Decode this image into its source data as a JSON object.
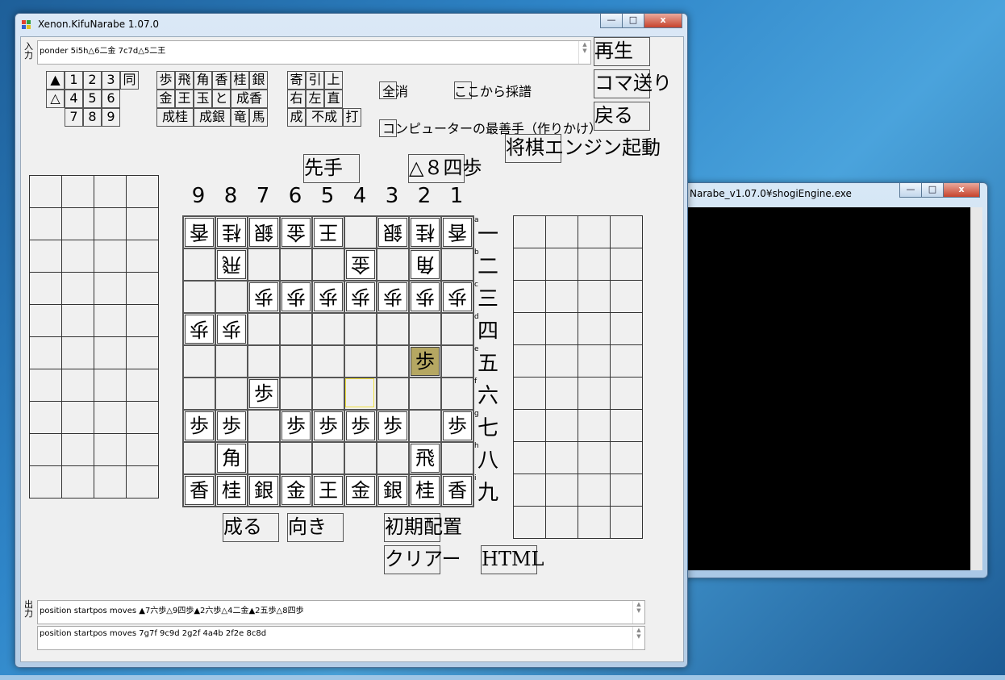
{
  "main_window": {
    "title": "Xenon.KifuNarabe 1.07.0"
  },
  "console_window": {
    "title": "Narabe_v1.07.0¥shogiEngine.exe"
  },
  "window_buttons": {
    "minimize": "—",
    "maximize": "□",
    "close": "x"
  },
  "input": {
    "label": "入力",
    "value": "ponder 5i5h△6二金 7c7d△5二王"
  },
  "output": {
    "label": "出力",
    "line1": "position startpos moves ▲7六歩△9四歩▲2六歩△4二金▲2五歩△8四歩",
    "line2": "position startpos moves 7g7f 9c9d 2g2f 4a4b 2f2e 8c8d"
  },
  "side_buttons": {
    "play": "再生",
    "step": "コマ送り",
    "back": "戻る",
    "engine": "将棋エンジン起動"
  },
  "keypad": {
    "row1": [
      "▲",
      "1",
      "2",
      "3",
      "同"
    ],
    "row2": [
      "△",
      "4",
      "5",
      "6"
    ],
    "row3": [
      "7",
      "8",
      "9"
    ]
  },
  "piece_buttons": {
    "row1": [
      "歩",
      "飛",
      "角",
      "香",
      "桂",
      "銀"
    ],
    "row2": [
      "金",
      "王",
      "玉",
      "と",
      "成香"
    ],
    "row3": [
      "成桂",
      "成銀",
      "竜",
      "馬"
    ]
  },
  "modifier_buttons": {
    "row1": [
      "寄",
      "引",
      "上"
    ],
    "row2": [
      "右",
      "左",
      "直"
    ],
    "row3": [
      "成",
      "不成",
      "打"
    ]
  },
  "options": {
    "clear_all": "全消",
    "record_from_here": "ここから採譜",
    "best_move": "コンピューターの最善手（作りかけ）"
  },
  "turn": {
    "label": "先手"
  },
  "last_move": {
    "label": "△８四歩"
  },
  "files": [
    "9",
    "8",
    "7",
    "6",
    "5",
    "4",
    "3",
    "2",
    "1"
  ],
  "ranks": [
    "一",
    "二",
    "三",
    "四",
    "五",
    "六",
    "七",
    "八",
    "九"
  ],
  "rank_letters": [
    "a",
    "b",
    "c",
    "d",
    "e",
    "f",
    "g",
    "h",
    "i"
  ],
  "bottom_buttons": {
    "promote": "成る",
    "direction": "向き",
    "initial": "初期配置",
    "clear": "クリアー",
    "html": "HTML"
  },
  "board": [
    {
      "file": 9,
      "rank": 1,
      "piece": "香",
      "side": "gote"
    },
    {
      "file": 8,
      "rank": 1,
      "piece": "桂",
      "side": "gote"
    },
    {
      "file": 7,
      "rank": 1,
      "piece": "銀",
      "side": "gote"
    },
    {
      "file": 6,
      "rank": 1,
      "piece": "金",
      "side": "gote"
    },
    {
      "file": 5,
      "rank": 1,
      "piece": "王",
      "side": "gote"
    },
    {
      "file": 3,
      "rank": 1,
      "piece": "銀",
      "side": "gote"
    },
    {
      "file": 2,
      "rank": 1,
      "piece": "桂",
      "side": "gote"
    },
    {
      "file": 1,
      "rank": 1,
      "piece": "香",
      "side": "gote"
    },
    {
      "file": 8,
      "rank": 2,
      "piece": "飛",
      "side": "gote"
    },
    {
      "file": 4,
      "rank": 2,
      "piece": "金",
      "side": "gote"
    },
    {
      "file": 2,
      "rank": 2,
      "piece": "角",
      "side": "gote"
    },
    {
      "file": 7,
      "rank": 3,
      "piece": "歩",
      "side": "gote"
    },
    {
      "file": 6,
      "rank": 3,
      "piece": "歩",
      "side": "gote"
    },
    {
      "file": 5,
      "rank": 3,
      "piece": "歩",
      "side": "gote"
    },
    {
      "file": 4,
      "rank": 3,
      "piece": "歩",
      "side": "gote"
    },
    {
      "file": 3,
      "rank": 3,
      "piece": "歩",
      "side": "gote"
    },
    {
      "file": 2,
      "rank": 3,
      "piece": "歩",
      "side": "gote"
    },
    {
      "file": 1,
      "rank": 3,
      "piece": "歩",
      "side": "gote"
    },
    {
      "file": 9,
      "rank": 4,
      "piece": "歩",
      "side": "gote"
    },
    {
      "file": 8,
      "rank": 4,
      "piece": "歩",
      "side": "gote"
    },
    {
      "file": 2,
      "rank": 5,
      "piece": "歩",
      "side": "sente",
      "highlight": true
    },
    {
      "file": 7,
      "rank": 6,
      "piece": "歩",
      "side": "sente"
    },
    {
      "file": 9,
      "rank": 7,
      "piece": "歩",
      "side": "sente"
    },
    {
      "file": 8,
      "rank": 7,
      "piece": "歩",
      "side": "sente"
    },
    {
      "file": 6,
      "rank": 7,
      "piece": "歩",
      "side": "sente"
    },
    {
      "file": 5,
      "rank": 7,
      "piece": "歩",
      "side": "sente"
    },
    {
      "file": 4,
      "rank": 7,
      "piece": "歩",
      "side": "sente"
    },
    {
      "file": 3,
      "rank": 7,
      "piece": "歩",
      "side": "sente"
    },
    {
      "file": 1,
      "rank": 7,
      "piece": "歩",
      "side": "sente"
    },
    {
      "file": 8,
      "rank": 8,
      "piece": "角",
      "side": "sente"
    },
    {
      "file": 2,
      "rank": 8,
      "piece": "飛",
      "side": "sente"
    },
    {
      "file": 9,
      "rank": 9,
      "piece": "香",
      "side": "sente"
    },
    {
      "file": 8,
      "rank": 9,
      "piece": "桂",
      "side": "sente"
    },
    {
      "file": 7,
      "rank": 9,
      "piece": "銀",
      "side": "sente"
    },
    {
      "file": 6,
      "rank": 9,
      "piece": "金",
      "side": "sente"
    },
    {
      "file": 5,
      "rank": 9,
      "piece": "王",
      "side": "sente"
    },
    {
      "file": 4,
      "rank": 9,
      "piece": "金",
      "side": "sente"
    },
    {
      "file": 3,
      "rank": 9,
      "piece": "銀",
      "side": "sente"
    },
    {
      "file": 2,
      "rank": 9,
      "piece": "桂",
      "side": "sente"
    },
    {
      "file": 1,
      "rank": 9,
      "piece": "香",
      "side": "sente"
    }
  ],
  "selected_square": {
    "file": 4,
    "rank": 6
  },
  "colors": {
    "highlight": "#b5a762",
    "selected_border": "#f0e040"
  }
}
